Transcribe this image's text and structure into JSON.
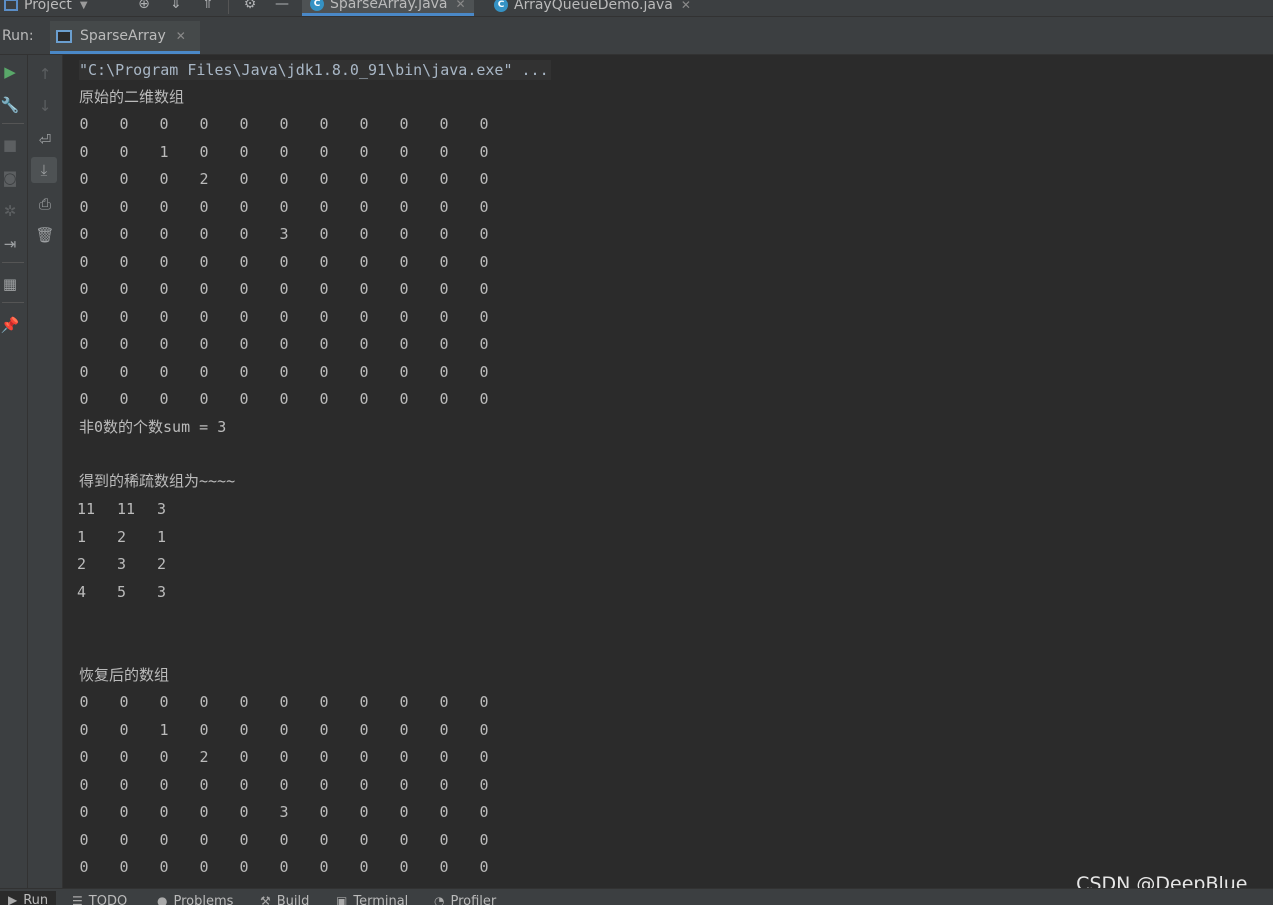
{
  "topbar": {
    "project_label": "Project",
    "editor_tabs": [
      {
        "label": "SparseArray.java",
        "active": true
      },
      {
        "label": "ArrayQueueDemo.java",
        "active": false
      }
    ]
  },
  "run_panel": {
    "label": "Run:",
    "tab_label": "SparseArray"
  },
  "console": {
    "command": "\"C:\\Program Files\\Java\\jdk1.8.0_91\\bin\\java.exe\" ...",
    "original_title": "原始的二维数组",
    "original_matrix": [
      [
        0,
        0,
        0,
        0,
        0,
        0,
        0,
        0,
        0,
        0,
        0
      ],
      [
        0,
        0,
        1,
        0,
        0,
        0,
        0,
        0,
        0,
        0,
        0
      ],
      [
        0,
        0,
        0,
        2,
        0,
        0,
        0,
        0,
        0,
        0,
        0
      ],
      [
        0,
        0,
        0,
        0,
        0,
        0,
        0,
        0,
        0,
        0,
        0
      ],
      [
        0,
        0,
        0,
        0,
        0,
        3,
        0,
        0,
        0,
        0,
        0
      ],
      [
        0,
        0,
        0,
        0,
        0,
        0,
        0,
        0,
        0,
        0,
        0
      ],
      [
        0,
        0,
        0,
        0,
        0,
        0,
        0,
        0,
        0,
        0,
        0
      ],
      [
        0,
        0,
        0,
        0,
        0,
        0,
        0,
        0,
        0,
        0,
        0
      ],
      [
        0,
        0,
        0,
        0,
        0,
        0,
        0,
        0,
        0,
        0,
        0
      ],
      [
        0,
        0,
        0,
        0,
        0,
        0,
        0,
        0,
        0,
        0,
        0
      ],
      [
        0,
        0,
        0,
        0,
        0,
        0,
        0,
        0,
        0,
        0,
        0
      ]
    ],
    "sum_line": "非0数的个数sum = 3",
    "sparse_title": "得到的稀疏数组为~~~~",
    "sparse_matrix": [
      [
        11,
        11,
        3
      ],
      [
        1,
        2,
        1
      ],
      [
        2,
        3,
        2
      ],
      [
        4,
        5,
        3
      ]
    ],
    "restored_title": "恢复后的数组",
    "restored_matrix": [
      [
        0,
        0,
        0,
        0,
        0,
        0,
        0,
        0,
        0,
        0,
        0
      ],
      [
        0,
        0,
        1,
        0,
        0,
        0,
        0,
        0,
        0,
        0,
        0
      ],
      [
        0,
        0,
        0,
        2,
        0,
        0,
        0,
        0,
        0,
        0,
        0
      ],
      [
        0,
        0,
        0,
        0,
        0,
        0,
        0,
        0,
        0,
        0,
        0
      ],
      [
        0,
        0,
        0,
        0,
        0,
        3,
        0,
        0,
        0,
        0,
        0
      ],
      [
        0,
        0,
        0,
        0,
        0,
        0,
        0,
        0,
        0,
        0,
        0
      ],
      [
        0,
        0,
        0,
        0,
        0,
        0,
        0,
        0,
        0,
        0,
        0
      ]
    ]
  },
  "watermark": "CSDN @DeepBlue_",
  "bottom_tabs": [
    {
      "label": "Run",
      "icon": "play-icon",
      "active": true
    },
    {
      "label": "TODO",
      "icon": "list-icon",
      "active": false
    },
    {
      "label": "Problems",
      "icon": "problems-icon",
      "active": false
    },
    {
      "label": "Build",
      "icon": "hammer-icon",
      "active": false
    },
    {
      "label": "Terminal",
      "icon": "terminal-icon",
      "active": false
    },
    {
      "label": "Profiler",
      "icon": "profiler-icon",
      "active": false
    }
  ]
}
